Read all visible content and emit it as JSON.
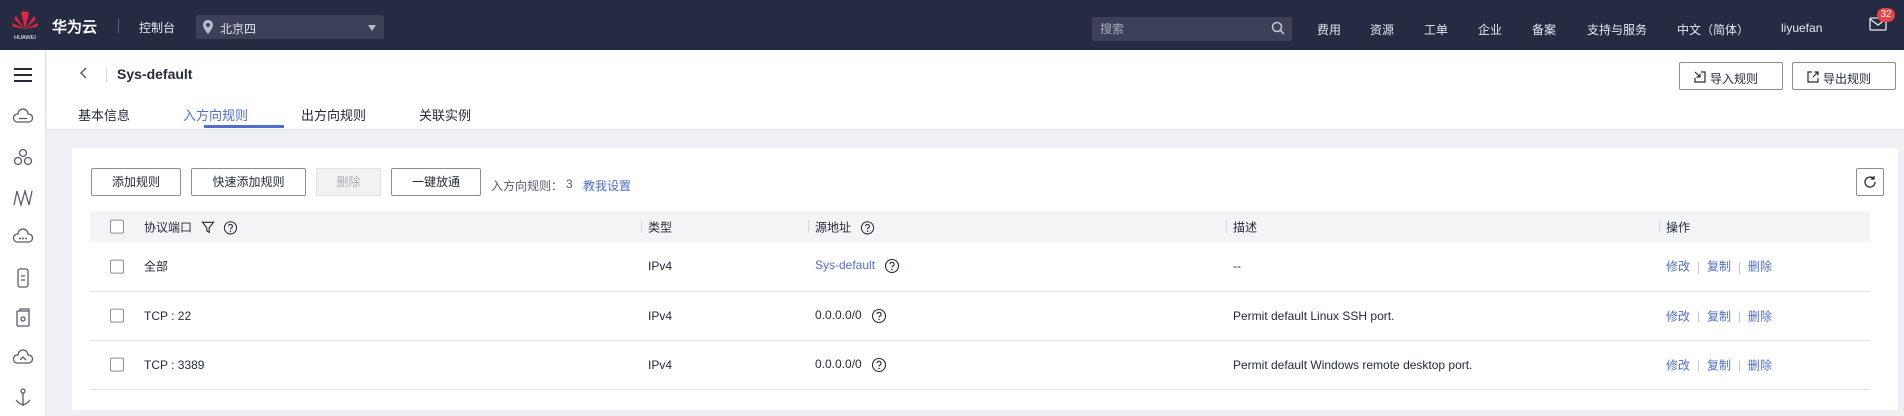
{
  "topbar": {
    "brand": "华为云",
    "console": "控制台",
    "region": "北京四",
    "search_placeholder": "搜索",
    "nav": [
      "费用",
      "资源",
      "工单",
      "企业",
      "备案",
      "支持与服务",
      "中文（简体）",
      "liyuefan"
    ],
    "badge": "32",
    "logo_text": "HUAWEI"
  },
  "header": {
    "title": "Sys-default",
    "tabs": [
      "基本信息",
      "入方向规则",
      "出方向规则",
      "关联实例"
    ],
    "active_tab": 1,
    "import_label": "导入规则",
    "export_label": "导出规则"
  },
  "toolbar": {
    "add": "添加规则",
    "quick_add": "快速添加规则",
    "delete": "删除",
    "one_click": "一键放通",
    "rule_label": "入方向规则：",
    "rule_count": "3",
    "teach": "教我设置"
  },
  "table": {
    "headers": {
      "protocol": "协议端口",
      "type": "类型",
      "source": "源地址",
      "desc": "描述",
      "ops": "操作"
    },
    "rows": [
      {
        "protocol": "全部",
        "type": "IPv4",
        "source": "Sys-default",
        "desc": "--"
      },
      {
        "protocol": "TCP : 22",
        "type": "IPv4",
        "source": "0.0.0.0/0",
        "desc": "Permit default Linux SSH port."
      },
      {
        "protocol": "TCP : 3389",
        "type": "IPv4",
        "source": "0.0.0.0/0",
        "desc": "Permit default Windows remote desktop port."
      }
    ],
    "ops": {
      "modify": "修改",
      "copy": "复制",
      "delete": "删除"
    }
  },
  "colors": {
    "topbar": "#262b44",
    "accent": "#526ecc",
    "badge": "#e54545"
  }
}
